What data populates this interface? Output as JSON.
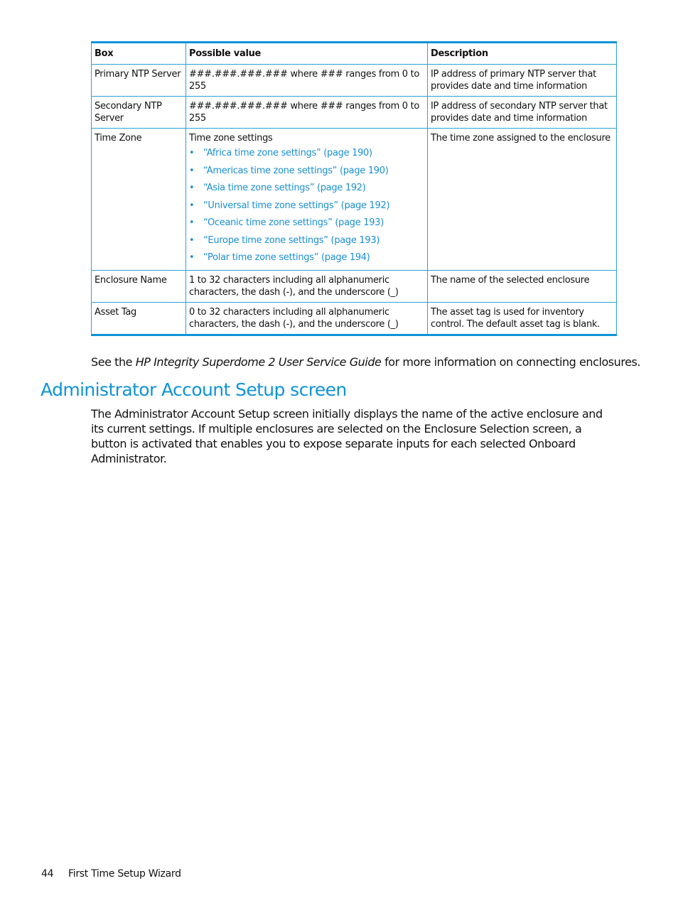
{
  "table": {
    "headers": [
      "Box",
      "Possible value",
      "Description"
    ],
    "rows": [
      {
        "box": "Primary NTP Server",
        "value": "###.###.###.### where ### ranges from 0 to 255",
        "description": "IP address of primary NTP server that provides date and time information"
      },
      {
        "box": "Secondary NTP Server",
        "value": "###.###.###.### where ### ranges from 0 to 255",
        "description": "IP address of secondary NTP server that provides date and time information"
      },
      {
        "box": "Time Zone",
        "value": "Time zone settings",
        "description": "The time zone assigned to the enclosure",
        "links": [
          "“Africa time zone settings” (page 190)",
          "“Americas time zone settings” (page 190)",
          "“Asia time zone settings” (page 192)",
          "“Universal time zone settings” (page 192)",
          "“Oceanic time zone settings” (page 193)",
          "“Europe time zone settings” (page 193)",
          "“Polar time zone settings” (page 194)"
        ]
      },
      {
        "box": "Enclosure Name",
        "value": "1 to 32 characters including all alphanumeric characters, the dash (-), and the underscore (_)",
        "description": "The name of the selected enclosure"
      },
      {
        "box": "Asset Tag",
        "value": "0 to 32 characters including all alphanumeric characters, the dash (-), and the underscore (_)",
        "description": "The asset tag is used for inventory control. The default asset tag is blank."
      }
    ]
  },
  "see_note": {
    "prefix": "See the ",
    "title": "HP Integrity Superdome 2 User Service Guide",
    "suffix": " for more information on connecting enclosures."
  },
  "section": {
    "heading": "Administrator Account Setup screen",
    "body": "The Administrator Account Setup screen initially displays the name of the active enclosure and its current settings. If multiple enclosures are selected on the Enclosure Selection screen, a button is activated that enables you to expose separate inputs for each selected Onboard Administrator."
  },
  "footer": {
    "page_number": "44",
    "chapter": "First Time Setup Wizard"
  },
  "colors": {
    "accent": "#0e93d8",
    "link": "#1a8fd4"
  }
}
